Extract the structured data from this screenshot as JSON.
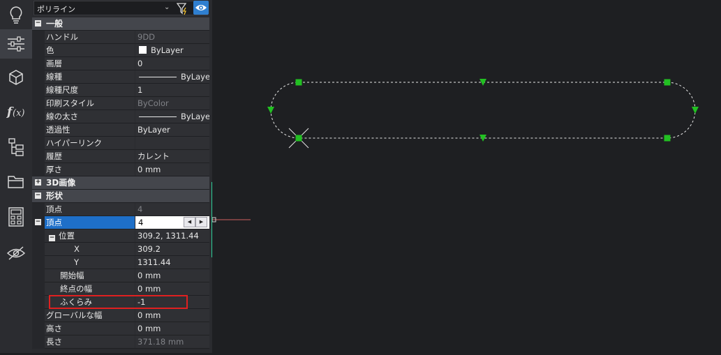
{
  "selector": {
    "value": "ポリライン"
  },
  "icons": [
    "lightbulb-icon",
    "sliders-icon",
    "cube-icon",
    "function-icon",
    "tree-icon",
    "folder-icon",
    "calculator-icon",
    "eye-hidden-icon"
  ],
  "categories": {
    "general": "一般",
    "image3d": "3D画像",
    "shape": "形状"
  },
  "general_rows": [
    {
      "label": "ハンドル",
      "value": "9DD",
      "gray": true
    },
    {
      "label": "色",
      "value": "ByLayer"
    },
    {
      "label": "画層",
      "value": "0"
    },
    {
      "label": "線種",
      "value": "ByLayer"
    },
    {
      "label": "線種尺度",
      "value": "1"
    },
    {
      "label": "印刷スタイル",
      "value": "ByColor",
      "gray": true
    },
    {
      "label": "線の太さ",
      "value": "ByLayer"
    },
    {
      "label": "透過性",
      "value": "ByLayer"
    },
    {
      "label": "ハイパーリンク",
      "value": ""
    },
    {
      "label": "履歴",
      "value": "カレント"
    },
    {
      "label": "厚さ",
      "value": "0 mm"
    }
  ],
  "shape_rows": {
    "vertex_count": {
      "label": "頂点",
      "value": "4"
    },
    "vertex": {
      "label": "頂点",
      "value": "4"
    },
    "position": {
      "label": "位置",
      "value": "309.2, 1311.44"
    },
    "x": {
      "label": "X",
      "value": "309.2"
    },
    "y": {
      "label": "Y",
      "value": "1311.44"
    },
    "start_width": {
      "label": "開始幅",
      "value": "0 mm"
    },
    "end_width": {
      "label": "終点の幅",
      "value": "0 mm"
    },
    "bulge": {
      "label": "ふくらみ",
      "value": "-1"
    },
    "global_width": {
      "label": "グローバルな幅",
      "value": "0 mm"
    },
    "elevation": {
      "label": "高さ",
      "value": "0 mm"
    },
    "length": {
      "label": "長さ",
      "value": "371.18 mm"
    }
  },
  "colors": {
    "accent": "#1e6fc8",
    "grip": "#22c022",
    "highlight": "#e02020"
  }
}
